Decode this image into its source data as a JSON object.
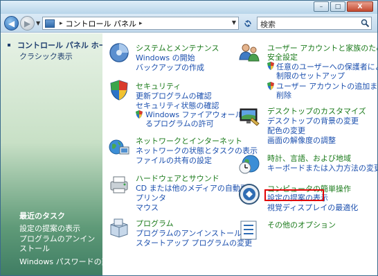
{
  "window": {
    "buttons": {
      "minimize": "–",
      "maximize": "□",
      "close": "X"
    }
  },
  "nav": {
    "back_icon": "back-arrow-icon",
    "forward_icon": "forward-arrow-icon",
    "address_path": "コントロール パネル",
    "search_placeholder": "検索"
  },
  "sidebar": {
    "home_label": "コントロール パネル ホーム",
    "classic_label": "クラシック表示",
    "recent_tasks_title": "最近のタスク",
    "recent_tasks": [
      "設定の提案の表示",
      "プログラムのアンインストール",
      "Windows パスワードの変更"
    ]
  },
  "categories": {
    "system": {
      "title": "システムとメンテナンス",
      "links": [
        "Windows の開始",
        "バックアップの作成"
      ]
    },
    "security": {
      "title": "セキュリティ",
      "links": [
        "更新プログラムの確認",
        "セキュリティ状態の確認",
        "Windows ファイアウォールによ",
        "るプログラムの許可"
      ]
    },
    "network": {
      "title": "ネットワークとインターネット",
      "links": [
        "ネットワークの状態とタスクの表示",
        "ファイルの共有の設定"
      ]
    },
    "hardware": {
      "title": "ハードウェアとサウンド",
      "links": [
        "CD または他のメディアの自動再生",
        "プリンタ",
        "マウス"
      ]
    },
    "programs": {
      "title": "プログラム",
      "links": [
        "プログラムのアンインストール",
        "スタートアップ プログラムの変更"
      ]
    },
    "users": {
      "title_line1": "ユーザー アカウントと家族のための",
      "title_line2": "安全設定",
      "links": [
        "任意のユーザーへの保護者による",
        "制限のセットアップ",
        "ユーザー アカウントの追加または",
        "削除"
      ]
    },
    "appearance": {
      "title": "デスクトップのカスタマイズ",
      "links": [
        "デスクトップの背景の変更",
        "配色の変更",
        "画面の解像度の調整"
      ]
    },
    "clock": {
      "title": "時計、言語、および地域",
      "links": [
        "キーボードまたは入力方法の変更"
      ]
    },
    "ease": {
      "title": "コンピュータの簡単操作",
      "links": [
        "設定の提案の表示",
        "視覚ディスプレイの最適化"
      ]
    },
    "other": {
      "title": "その他のオプション"
    }
  },
  "colors": {
    "category_title": "#1a7a1a",
    "link": "#1b4fae",
    "highlight_border": "#e00000"
  }
}
